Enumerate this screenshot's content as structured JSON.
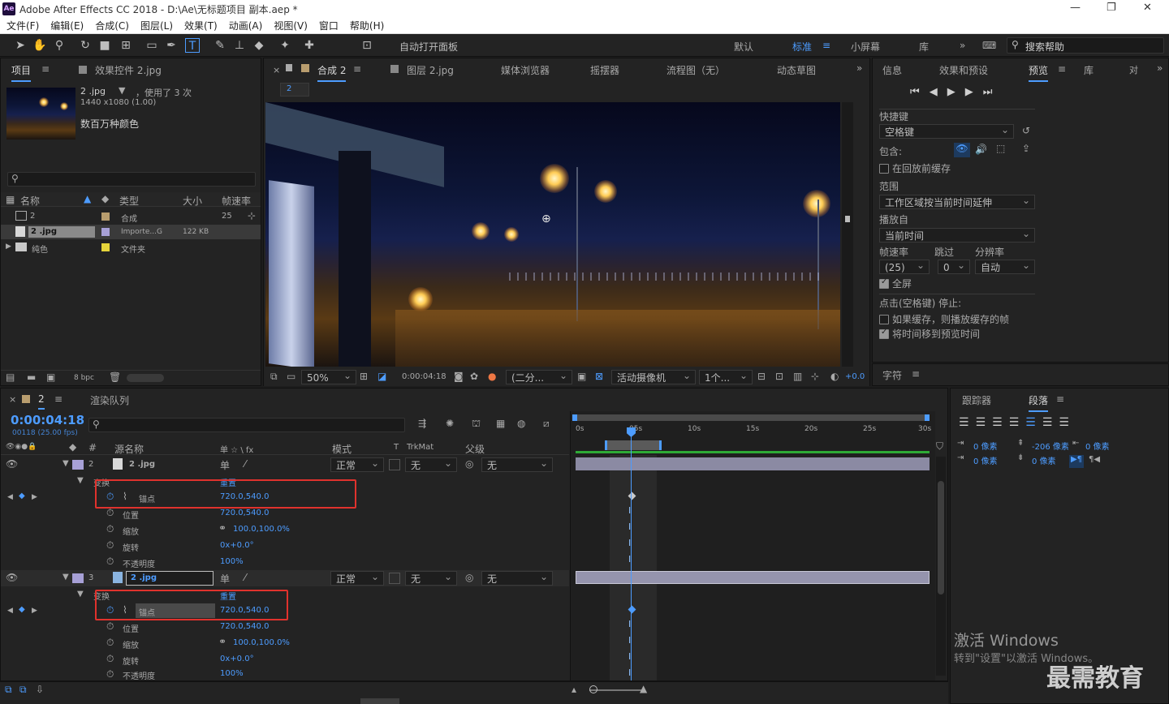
{
  "window": {
    "app_logo": "Ae",
    "title": "Adobe After Effects CC 2018 - D:\\Ae\\无标题项目 副本.aep *",
    "minimize": "—",
    "maximize": "❐",
    "close": "✕"
  },
  "menu": [
    "文件(F)",
    "编辑(E)",
    "合成(C)",
    "图层(L)",
    "效果(T)",
    "动画(A)",
    "视图(V)",
    "窗口",
    "帮助(H)"
  ],
  "toolbar": {
    "auto_open_panels": "自动打开面板",
    "workspaces": [
      "默认",
      "标准",
      "小屏幕",
      "库"
    ],
    "active_workspace": "标准",
    "search_help": "搜索帮助",
    "more": "»"
  },
  "project_panel": {
    "tab_project": "项目",
    "tab_effects": "效果控件 2.jpg",
    "selected_name": "2 .jpg",
    "used_times": "，使用了 3 次",
    "dimensions": "1440 x1080 (1.00)",
    "color_mode": "数百万种颜色",
    "columns": [
      "名称",
      "类型",
      "大小",
      "帧速率"
    ],
    "items": [
      {
        "name": "2",
        "type": "合成",
        "size": "",
        "fps": "25"
      },
      {
        "name": "2 .jpg",
        "type": "Importe...G",
        "size": "122 KB",
        "fps": ""
      },
      {
        "name": "纯色",
        "type": "文件夹",
        "size": "",
        "fps": ""
      }
    ],
    "bpc": "8 bpc"
  },
  "composition_panel": {
    "tabs": [
      "合成 2",
      "图层 2.jpg",
      "媒体浏览器",
      "摇摆器",
      "流程图（无）",
      "动态草图"
    ],
    "comp_chip": "2",
    "zoom": "50%",
    "time": "0:00:04:18",
    "resolution": "(二分...",
    "camera": "活动摄像机",
    "views": "1个...",
    "exposure": "+0.0"
  },
  "right_panel": {
    "tabs": [
      "信息",
      "效果和预设",
      "预览",
      "库"
    ],
    "truncated_tab": "对",
    "shortcut_label": "快捷键",
    "shortcut_value": "空格键",
    "include_label": "包含:",
    "cache_before": "在回放前缓存",
    "range_label": "范围",
    "range_value": "工作区域按当前时间延伸",
    "play_from_label": "播放自",
    "play_from_value": "当前时间",
    "fps_label": "帧速率",
    "skip_label": "跳过",
    "res_label": "分辨率",
    "fps_value": "(25)",
    "skip_value": "0",
    "res_value": "自动",
    "fullscreen": "全屏",
    "stop_label": "点击(空格键) 停止:",
    "if_cached": "如果缓存，则播放缓存的帧",
    "move_time": "将时间移到预览时间",
    "char_tab": "字符"
  },
  "timeline": {
    "tab_comp": "2",
    "tab_render": "渲染队列",
    "current_time": "0:00:04:18",
    "frame_info": "00118 (25.00 fps)",
    "columns": {
      "source_name": "源名称",
      "switches": "单 ☆ \\ fx",
      "mode": "模式",
      "t": "T",
      "trkmat": "TrkMat",
      "parent": "父级"
    },
    "ruler": [
      "0s",
      "05s",
      "10s",
      "15s",
      "20s",
      "25s",
      "30s"
    ],
    "layers": [
      {
        "num": "2",
        "name": "2 .jpg",
        "mode": "正常",
        "trkmat": "无",
        "parent": "无",
        "group": "变换",
        "reset": "重置",
        "props": [
          {
            "name": "锚点",
            "value": "720.0,540.0"
          },
          {
            "name": "位置",
            "value": "720.0,540.0"
          },
          {
            "name": "缩放",
            "value": "100.0,100.0%"
          },
          {
            "name": "旋转",
            "value": "0x+0.0°"
          },
          {
            "name": "不透明度",
            "value": "100%"
          }
        ]
      },
      {
        "num": "3",
        "name": "2 .jpg",
        "mode": "正常",
        "trkmat": "无",
        "parent": "无",
        "group": "变换",
        "reset": "重置",
        "props": [
          {
            "name": "锚点",
            "value": "720.0,540.0"
          },
          {
            "name": "位置",
            "value": "720.0,540.0"
          },
          {
            "name": "缩放",
            "value": "100.0,100.0%"
          },
          {
            "name": "旋转",
            "value": "0x+0.0°"
          },
          {
            "name": "不透明度",
            "value": "100%"
          }
        ]
      }
    ]
  },
  "paragraph_panel": {
    "tabs": [
      "跟踪器",
      "段落"
    ],
    "indent_left": "0 像素",
    "space_before": "-206 像素",
    "indent_right": "0 像素",
    "first_indent": "0 像素",
    "space_after": "0 像素"
  },
  "watermark": {
    "activate_title": "激活 Windows",
    "activate_sub": "转到\"设置\"以激活 Windows。",
    "brand": "最需教育"
  },
  "colors": {
    "accent": "#4d9cff",
    "highlight": "#e0322d",
    "panel": "#232323",
    "layer_bar": "#8b8aa3"
  }
}
